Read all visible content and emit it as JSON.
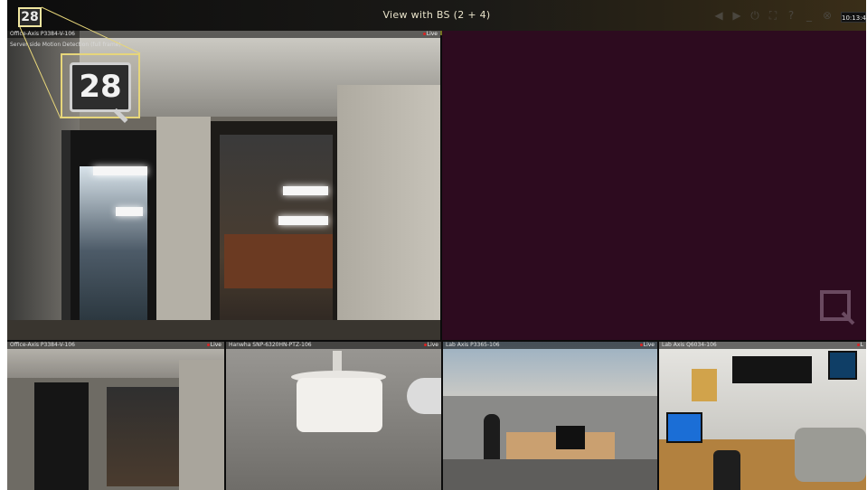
{
  "window": {
    "title": "View with BS (2 + 4)",
    "logo_number": "28",
    "clock": "10:13:4",
    "toolbar_icons": [
      "back-arrow-icon",
      "forward-arrow-icon",
      "power-icon",
      "screenshot-icon",
      "help-icon",
      "minimize-icon",
      "close-icon"
    ]
  },
  "tiles": [
    {
      "name": "Office-Axis P3384-V-106",
      "live": "Live",
      "subtitle": "Server side Motion Detection (full frame)"
    },
    {
      "name": "",
      "live": ""
    },
    {
      "name": "Office-Axis P3384-V-106",
      "live": "Live"
    },
    {
      "name": "Hanwha SNP-6320HN-PTZ-106",
      "live": "Live"
    },
    {
      "name": "Lab Axis P3365-106",
      "live": "Live"
    },
    {
      "name": "Lab Axis Q6034-106",
      "live": "L"
    }
  ],
  "callout": {
    "number": "28"
  },
  "colors": {
    "accent": "#e7d67a",
    "live_dot": "#dd2222",
    "empty_tile": "#2d0b1f"
  }
}
